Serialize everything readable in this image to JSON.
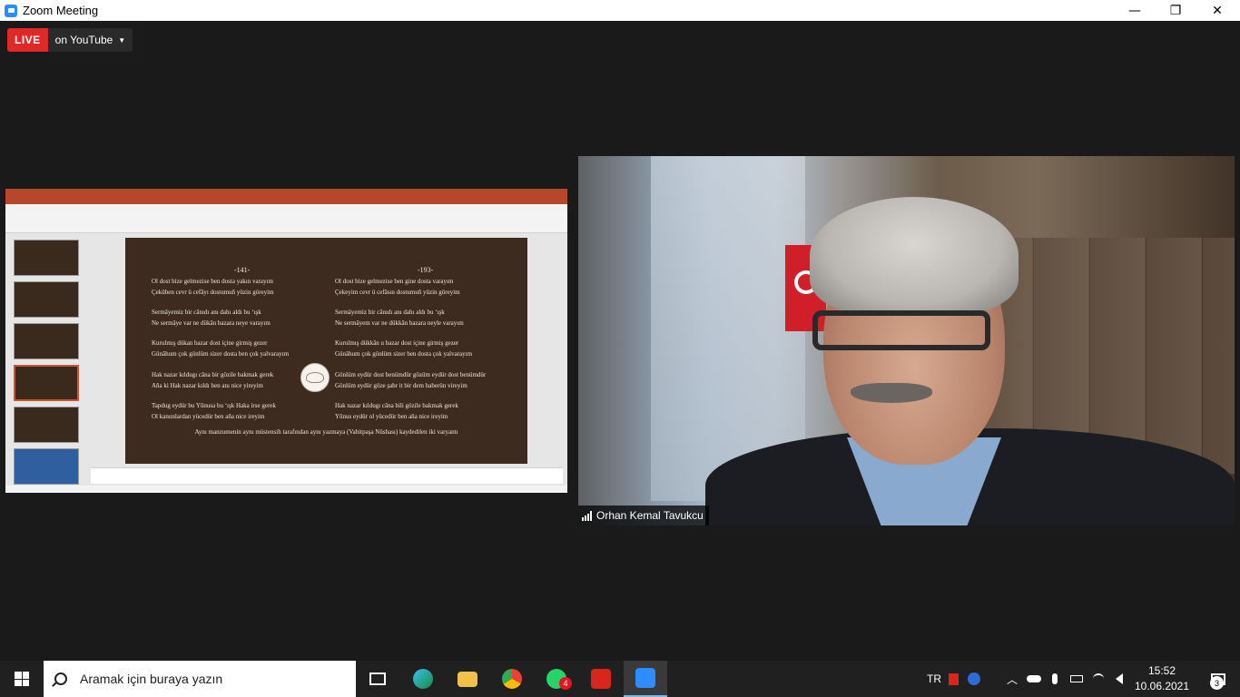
{
  "window": {
    "title": "Zoom Meeting",
    "minimize": "—",
    "maximize": "❐",
    "close": "✕"
  },
  "live": {
    "badge": "LIVE",
    "label": "on YouTube"
  },
  "share": {
    "slide": {
      "col1_heading": "-141-",
      "col2_heading": "-193-",
      "col1": [
        [
          "Ol dost bize gelmezise ben dosta yakın varayım",
          "Çeküben cevr ü cefâyı dostumuñ yüzin göreyim"
        ],
        [
          "Sermâyemiz bir cânıdı anı dahı aldı bu ‘ışk",
          "Ne sermâye var ne dükân bazara neye varayım"
        ],
        [
          "Kurulmış dükan bazar dost içine girmiş gezer",
          "Günâhum çok gönlüm sizer dosta ben çok yalvarayım"
        ],
        [
          "Hak nazar kıldugı câna bir gözile bakmak gerek",
          "Aña ki Hak nazar kıldı ben anı nice yireyim"
        ],
        [
          "Tapdug eydür bu Yûnusa bu ‘ışk Haka irse gerek",
          "Ol kanunlardan yücedür ben aña nice ireyim"
        ]
      ],
      "col2": [
        [
          "Ol dost bize gelmezise ben gine dosta varayım",
          "Çekeyim cevr ü cefâsın dostumuñ yüzin göreyim"
        ],
        [
          "Sermâyemiz bir cânıdı anı dahı aldı bu ‘ışk",
          "Ne sermâyem var ne dükkân bazara neyle varayım"
        ],
        [
          "Kurulmış dükkân u bazar dost içine girmiş gezer",
          "Günâhum çok gönlüm sizer ben dosta çok yalvarayım"
        ],
        [
          "Gönlüm eydür dost benümdür gözüm eydür dost benümdür",
          "Gönlüm eydür göze şabr it bir dem haberün vireyim"
        ],
        [
          "Hak nazar kıldugı câna bili gözile bakmak gerek",
          "Yûnus eydür ol yücedür ben aña nice ireyim"
        ]
      ],
      "footer": "Aynı manzumenin aynı müstensih tarafından aynı yazmaya (Vahitpaşa Nüshası) kaydedilen iki varyantı"
    }
  },
  "participant": {
    "name": "Orhan Kemal Tavukcu"
  },
  "taskbar": {
    "search_placeholder": "Aramak için buraya yazın",
    "whatsapp_badge": "4",
    "language": "TR",
    "time": "15:52",
    "date": "10.06.2021",
    "notification_count": "3"
  }
}
